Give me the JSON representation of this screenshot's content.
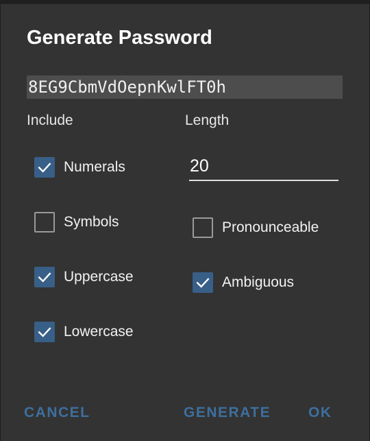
{
  "dialog": {
    "title": "Generate Password",
    "password": "8EG9CbmVdOepnKwlFT0h"
  },
  "include": {
    "label": "Include",
    "options": [
      {
        "label": "Numerals",
        "checked": true
      },
      {
        "label": "Symbols",
        "checked": false
      },
      {
        "label": "Uppercase",
        "checked": true
      },
      {
        "label": "Lowercase",
        "checked": true
      }
    ]
  },
  "length": {
    "label": "Length",
    "value": "20",
    "options": [
      {
        "label": "Pronounceable",
        "checked": false
      },
      {
        "label": "Ambiguous",
        "checked": true
      }
    ]
  },
  "actions": {
    "cancel": "CANCEL",
    "generate": "GENERATE",
    "ok": "OK"
  },
  "colors": {
    "accent": "#385f87",
    "action_text": "#3d6f9e",
    "background": "#333333"
  },
  "icons": {
    "checked": "checkmark-icon"
  }
}
